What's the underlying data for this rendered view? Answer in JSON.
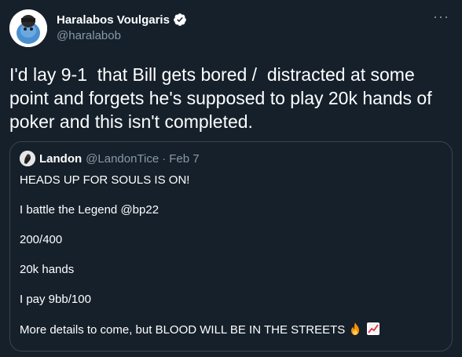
{
  "author": {
    "name": "Haralabos Voulgaris",
    "handle": "@haralabob"
  },
  "more_icon": "more-horizontal-icon",
  "tweet_text": "I'd lay 9-1  that Bill gets bored /  distracted at some point and forgets he's supposed to play 20k hands of poker and this isn't completed.",
  "quoted": {
    "name": "Landon",
    "handle": "@LandonTice",
    "separator": "·",
    "date": "Feb 7",
    "lines": [
      "HEADS UP FOR SOULS IS ON!",
      "I battle the Legend @bp22",
      "200/400",
      "20k hands",
      "I pay 9bb/100",
      "More details to come, but BLOOD WILL BE IN THE STREETS"
    ]
  },
  "colors": {
    "background": "#15202b",
    "secondary_text": "#8899a6",
    "border": "#38444d",
    "verified": "#ffffff"
  }
}
